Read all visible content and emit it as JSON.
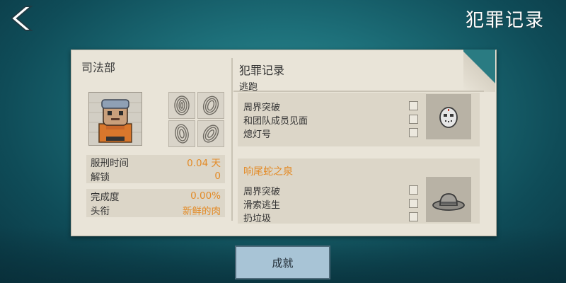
{
  "header": {
    "title": "犯罪记录",
    "back_icon": "chevron-left-icon"
  },
  "left_panel": {
    "title": "司法部",
    "portrait_icon": "prisoner-portrait-icon",
    "fingerprint_icon": "fingerprint-icon",
    "stats": [
      {
        "label": "服刑时间",
        "value": "0.04 天"
      },
      {
        "label": "解锁",
        "value": "0"
      },
      {
        "label": "完成度",
        "value": "0.00%"
      },
      {
        "label": "头衔",
        "value": "新鲜的肉"
      }
    ]
  },
  "right_panel": {
    "title": "犯罪记录",
    "subtitle": "逃跑",
    "cards": [
      {
        "title": "",
        "tasks": [
          "周界突破",
          "和团队成员见面",
          "熄灯号"
        ],
        "checked": [
          false,
          false,
          false
        ],
        "reward_icon": "hockey-mask-icon"
      },
      {
        "title": "响尾蛇之泉",
        "tasks": [
          "周界突破",
          "滑索逃生",
          "扔垃圾"
        ],
        "checked": [
          false,
          false,
          false
        ],
        "reward_icon": "cowboy-hat-icon"
      }
    ]
  },
  "footer": {
    "achievements_label": "成就"
  },
  "colors": {
    "accent": "#e38b27",
    "paper": "#e9e4d8",
    "button": "#a8c4d6"
  }
}
